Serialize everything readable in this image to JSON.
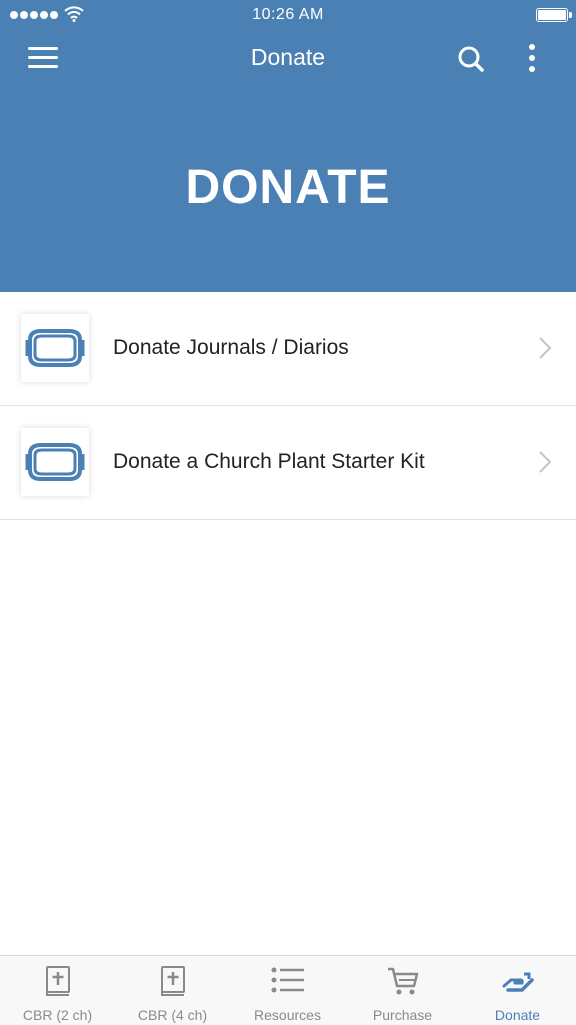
{
  "status_bar": {
    "time": "10:26 AM"
  },
  "header": {
    "title": "Donate",
    "hero_title": "DONATE"
  },
  "list": {
    "items": [
      {
        "label": "Donate Journals / Diarios",
        "icon": "donate-card-icon"
      },
      {
        "label": "Donate a Church Plant Starter Kit",
        "icon": "donate-card-icon"
      }
    ]
  },
  "tabbar": {
    "tabs": [
      {
        "label": "CBR (2 ch)",
        "icon": "bible-icon"
      },
      {
        "label": "CBR (4 ch)",
        "icon": "bible-icon"
      },
      {
        "label": "Resources",
        "icon": "list-icon"
      },
      {
        "label": "Purchase",
        "icon": "cart-icon"
      },
      {
        "label": "Donate",
        "icon": "donate-hand-icon",
        "active": true
      }
    ]
  },
  "colors": {
    "brand": "#4b80b4",
    "tab_inactive": "#8a8a8a"
  }
}
